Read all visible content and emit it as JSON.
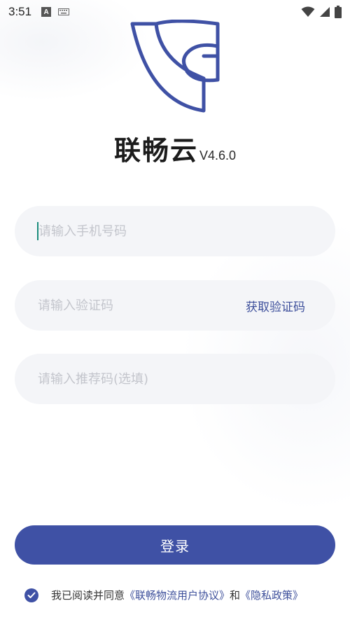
{
  "status_bar": {
    "time": "3:51",
    "notification_a": "A",
    "icons": [
      "a-notification-icon",
      "keyboard-icon",
      "wifi-icon",
      "cellular-signal-icon",
      "battery-icon"
    ]
  },
  "app": {
    "name": "联畅云",
    "version": "V4.6.0",
    "logo_icon": "app-logo-icon",
    "brand_color": "#3f51a5"
  },
  "form": {
    "phone_placeholder": "请输入手机号码",
    "code_placeholder": "请输入验证码",
    "get_code_label": "获取验证码",
    "referral_placeholder": "请输入推荐码(选填)"
  },
  "login_label": "登录",
  "agreement": {
    "checked": true,
    "prefix": "我已阅读并同意",
    "user_agreement": "《联畅物流用户协议》",
    "and": "和",
    "privacy_policy": "《隐私政策》"
  }
}
